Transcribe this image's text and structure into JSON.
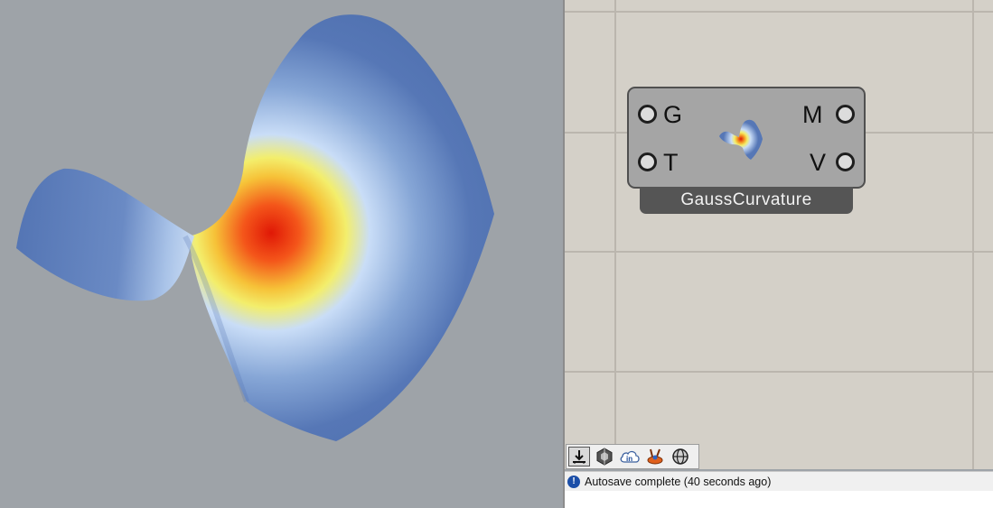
{
  "viewport": {
    "label": "3D viewport - Gaussian curvature surface"
  },
  "component": {
    "name": "GaussCurvature",
    "inputs": [
      {
        "label": "G"
      },
      {
        "label": "T"
      }
    ],
    "outputs": [
      {
        "label": "M"
      },
      {
        "label": "V"
      }
    ]
  },
  "toolbar": {
    "buttons": [
      {
        "icon": "download-icon"
      },
      {
        "icon": "crystal-icon"
      },
      {
        "icon": "cloud-in-icon"
      },
      {
        "icon": "rabbit-icon"
      },
      {
        "icon": "sphere-icon"
      }
    ]
  },
  "status": {
    "text": "Autosave complete (40 seconds ago)"
  },
  "colors": {
    "viewport_bg": "#9ea3a8",
    "canvas_bg": "#d4d0c8",
    "surface_blue": "#5677b6",
    "surface_light": "#c7dcf7",
    "curvature_yellow": "#f5ec5e",
    "curvature_red": "#e82a10"
  }
}
